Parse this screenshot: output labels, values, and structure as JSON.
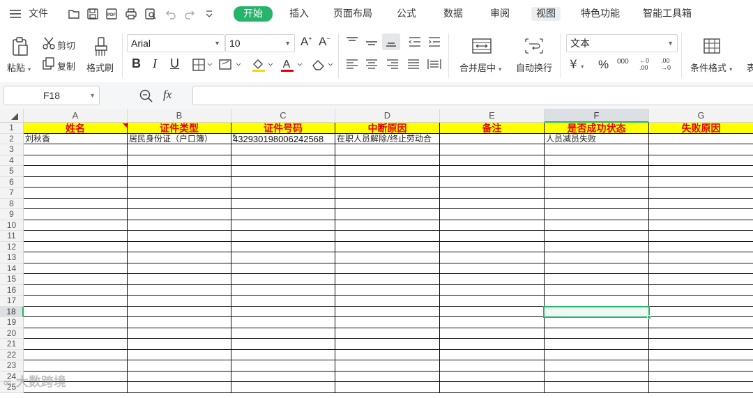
{
  "menu": {
    "file": "文件",
    "tabs": [
      "开始",
      "插入",
      "页面布局",
      "公式",
      "数据",
      "审阅",
      "视图",
      "特色功能",
      "智能工具箱"
    ]
  },
  "ribbon": {
    "paste": "粘贴",
    "cut": "剪切",
    "copy": "复制",
    "format_painter": "格式刷",
    "font_name": "Arial",
    "font_size": "10",
    "merge_center": "合并居中",
    "wrap_text": "自动换行",
    "number_format": "文本",
    "percent": "%",
    "thousands": "000",
    "dec_increase": "←0 .00",
    "dec_decrease": ".00 →0",
    "conditional_format": "条件格式",
    "overflow_char": "表"
  },
  "formula_bar": {
    "cell_ref": "F18",
    "fx": "fx",
    "value": ""
  },
  "sheet": {
    "columns": [
      "A",
      "B",
      "C",
      "D",
      "E",
      "F",
      "G"
    ],
    "headers": [
      "姓名",
      "证件类型",
      "证件号码",
      "中断原因",
      "备注",
      "是否成功状态",
      "失败原因"
    ],
    "row2": [
      "刘秋香",
      "居民身份证（户口簿）",
      "432930198006242568",
      "在职人员解除/终止劳动合",
      "",
      "人员减员失败",
      ""
    ],
    "row_numbers": [
      "1",
      "2",
      "3",
      "4",
      "5",
      "6",
      "7",
      "8",
      "9",
      "10",
      "11",
      "12",
      "13",
      "14",
      "15",
      "16",
      "17",
      "18",
      "19",
      "20",
      "21",
      "22",
      "23",
      "24",
      "25"
    ],
    "selected_cell": "F18"
  },
  "watermark": "大数跨境"
}
